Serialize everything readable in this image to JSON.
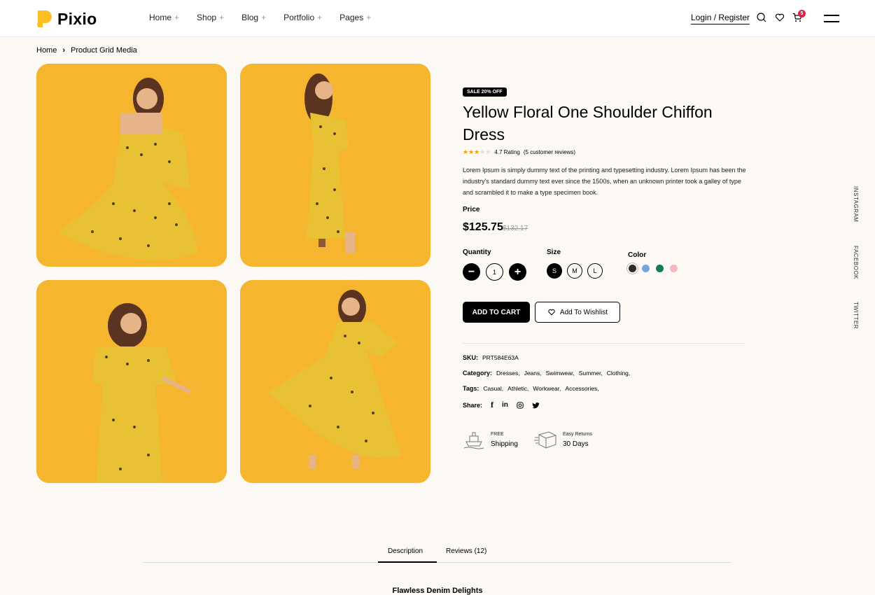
{
  "brand": {
    "name": "Pixio",
    "accent": "#fbbf24"
  },
  "nav": [
    {
      "label": "Home"
    },
    {
      "label": "Shop"
    },
    {
      "label": "Blog"
    },
    {
      "label": "Portfolio"
    },
    {
      "label": "Pages"
    }
  ],
  "nav_plus": "+",
  "header": {
    "login_label": "Login / Register",
    "cart_count": "5"
  },
  "breadcrumb": {
    "home": "Home",
    "sep": "›",
    "current": "Product Grid Media"
  },
  "product": {
    "badge": "SALE 20% OFF",
    "title": "Yellow Floral One Shoulder Chiffon Dress",
    "rating_value": 3,
    "rating_text": "4.7 Rating",
    "reviews_text": "(5 customer reviews)",
    "description": "Lorem Ipsum is simply dummy text of the printing and typesetting industry. Lorem Ipsum has been the industry's standard dummy text ever since the 1500s, when an unknown printer took a galley of type and scrambled it to make a type specimen book.",
    "price_label": "Price",
    "price": "$125.75",
    "old_price": "$132.17",
    "quantity_label": "Quantity",
    "quantity_value": "1",
    "size_label": "Size",
    "sizes": [
      "S",
      "M",
      "L"
    ],
    "selected_size": "S",
    "color_label": "Color",
    "colors": [
      "#2b2b2b",
      "#7ba5d6",
      "#0f7a5c",
      "#f5b9c0"
    ],
    "add_to_cart": "ADD TO CART",
    "wishlist": "Add To Wishlist",
    "sku_label": "SKU:",
    "sku_value": "PRT584E63A",
    "category_label": "Category:",
    "categories": [
      "Dresses,",
      "Jeans,",
      "Swimwear,",
      "Summer,",
      "Clothing,"
    ],
    "tags_label": "Tags:",
    "tags": [
      "Casual,",
      "Athletic,",
      "Workwear,",
      "Accessories,"
    ],
    "share_label": "Share:",
    "share_icons": [
      "f",
      "in",
      "◎",
      "🐦"
    ]
  },
  "features": [
    {
      "small": "FREE",
      "big": "Shipping",
      "icon": "ship-icon"
    },
    {
      "small": "Easy Returns",
      "big": "30 Days",
      "icon": "box-icon"
    }
  ],
  "social": [
    "INSTAGRAM",
    "FACEBOOK",
    "TWITTER"
  ],
  "tabs": [
    {
      "label": "Description"
    },
    {
      "label": "Reviews (12)"
    }
  ],
  "section_title": "Flawless Denim Delights"
}
